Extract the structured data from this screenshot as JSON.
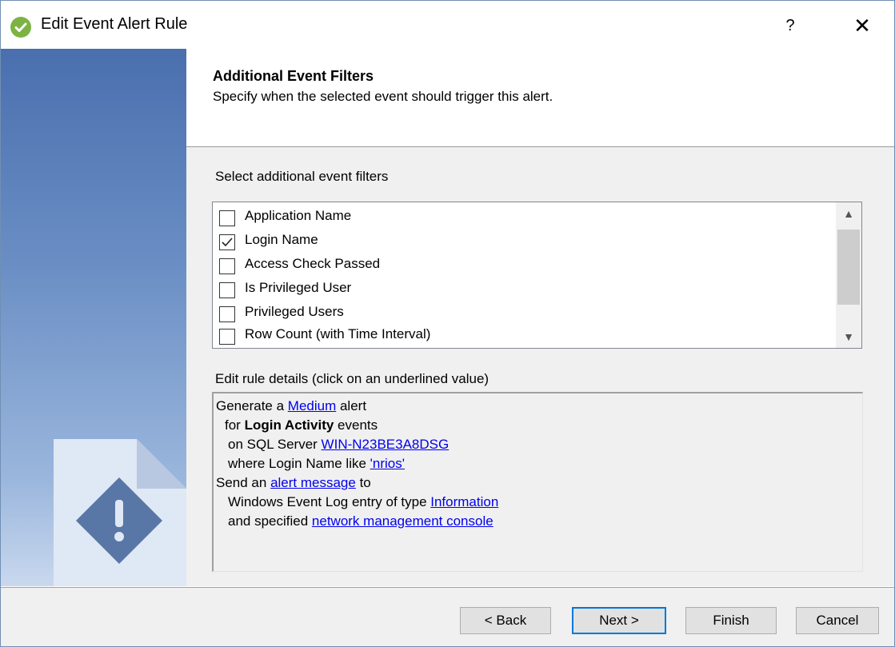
{
  "window": {
    "title": "Edit Event Alert Rule",
    "help_label": "?",
    "close_label": "✕"
  },
  "header": {
    "title": "Additional Event Filters",
    "subtitle": "Specify when the selected event should trigger this alert."
  },
  "filters": {
    "label": "Select additional event filters",
    "items": [
      {
        "label": "Application Name",
        "checked": false
      },
      {
        "label": "Login Name",
        "checked": true
      },
      {
        "label": "Access Check Passed",
        "checked": false
      },
      {
        "label": "Is Privileged User",
        "checked": false
      },
      {
        "label": "Privileged Users",
        "checked": false
      },
      {
        "label": "Row Count (with Time Interval)",
        "checked": false
      }
    ]
  },
  "details": {
    "label": "Edit rule details (click on an underlined value)",
    "l1_pre": "Generate a ",
    "l1_link": "Medium",
    "l1_post": " alert",
    "l2_pre": "for ",
    "l2_bold": "Login Activity",
    "l2_post": " events",
    "l3_pre": "on SQL Server ",
    "l3_link": "WIN-N23BE3A8DSG",
    "l4_pre": "where Login Name like ",
    "l4_link": "'nrios'",
    "l5_pre": "Send an ",
    "l5_link": "alert message",
    "l5_post": " to",
    "l6_pre": "Windows Event Log entry of type ",
    "l6_link": "Information",
    "l7_pre": "and specified ",
    "l7_link": "network management console"
  },
  "buttons": {
    "back": "< Back",
    "next": "Next >",
    "finish": "Finish",
    "cancel": "Cancel"
  },
  "colors": {
    "link": "#0000ee",
    "accent": "#0078d7",
    "icon_green": "#7cb342"
  }
}
